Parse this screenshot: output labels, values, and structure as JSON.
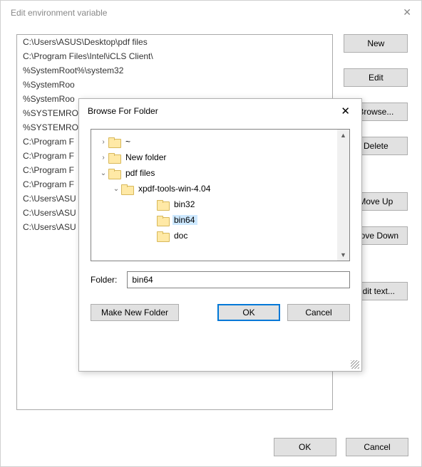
{
  "parent_dialog": {
    "title": "Edit environment variable",
    "env_paths": [
      "C:\\Users\\ASUS\\Desktop\\pdf files",
      "C:\\Program Files\\Intel\\iCLS Client\\",
      "%SystemRoot%\\system32",
      "%SystemRoo",
      "%SystemRoo",
      "%SYSTEMRO",
      "%SYSTEMRO",
      "C:\\Program F",
      "C:\\Program F",
      "C:\\Program F",
      "C:\\Program F",
      "C:\\Users\\ASU",
      "C:\\Users\\ASU",
      "C:\\Users\\ASU"
    ],
    "buttons": {
      "new": "New",
      "edit": "Edit",
      "browse": "Browse...",
      "delete": "Delete",
      "move_up": "Move Up",
      "move_down": "Move Down",
      "edit_text": "Edit text...",
      "ok": "OK",
      "cancel": "Cancel"
    }
  },
  "modal": {
    "title": "Browse For Folder",
    "tree": [
      {
        "label": "~",
        "indent": 1,
        "chevron": "right",
        "selected": false
      },
      {
        "label": "New folder",
        "indent": 1,
        "chevron": "right",
        "selected": false
      },
      {
        "label": "pdf files",
        "indent": 1,
        "chevron": "down",
        "selected": false
      },
      {
        "label": "xpdf-tools-win-4.04",
        "indent": 2,
        "chevron": "down",
        "selected": false
      },
      {
        "label": "bin32",
        "indent": 4,
        "chevron": "",
        "selected": false
      },
      {
        "label": "bin64",
        "indent": 4,
        "chevron": "",
        "selected": true
      },
      {
        "label": "doc",
        "indent": 4,
        "chevron": "",
        "selected": false
      }
    ],
    "folder_label": "Folder:",
    "folder_value": "bin64",
    "buttons": {
      "make_new": "Make New Folder",
      "ok": "OK",
      "cancel": "Cancel"
    }
  }
}
